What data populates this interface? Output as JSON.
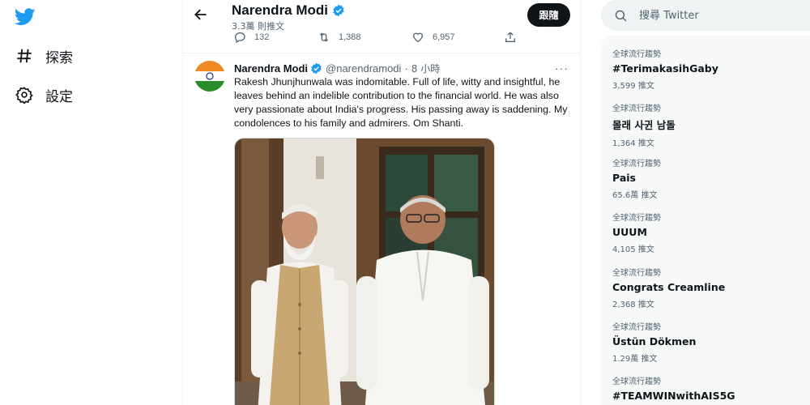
{
  "nav": {
    "items": [
      {
        "label": "探索",
        "icon": "hashtag-icon"
      },
      {
        "label": "設定",
        "icon": "gear-icon"
      }
    ],
    "logo_icon": "twitter-bird-icon"
  },
  "header": {
    "name": "Narendra Modi",
    "tweet_count": "3.3萬 則推文",
    "follow_label": "跟隨"
  },
  "prev_tweet_actions": {
    "replies": "132",
    "retweets": "1,388",
    "likes": "6,957"
  },
  "tweet": {
    "name": "Narendra Modi",
    "handle": "@narendramodi",
    "separator": "·",
    "time": "8 小時",
    "more": "···",
    "text": "Rakesh Jhunjhunwala was indomitable. Full of life, witty and insightful, he leaves behind an indelible contribution to the financial world. He was also very passionate about India's progress. His passing away is saddening. My condolences to his family and admirers. Om Shanti."
  },
  "search": {
    "placeholder": "搜尋 Twitter"
  },
  "trends": [
    {
      "context": "全球流行趨勢",
      "title": "#TerimakasihGaby",
      "count": "3,599 推文"
    },
    {
      "context": "全球流行趨勢",
      "title": "몰래 사귄 남돌",
      "count": "1,364 推文"
    },
    {
      "context": "全球流行趨勢",
      "title": "Pais",
      "count": "65.6萬 推文"
    },
    {
      "context": "全球流行趨勢",
      "title": "UUUM",
      "count": "4,105 推文"
    },
    {
      "context": "全球流行趨勢",
      "title": "Congrats Creamline",
      "count": "2,368 推文"
    },
    {
      "context": "全球流行趨勢",
      "title": "Üstün Dökmen",
      "count": "1.29萬 推文"
    },
    {
      "context": "全球流行趨勢",
      "title": "#TEAMWINwithAIS5G",
      "count": ""
    }
  ],
  "colors": {
    "brand": "#1d9bf0",
    "text": "#0f1419",
    "muted": "#536471",
    "verified": "#1d9bf0"
  }
}
